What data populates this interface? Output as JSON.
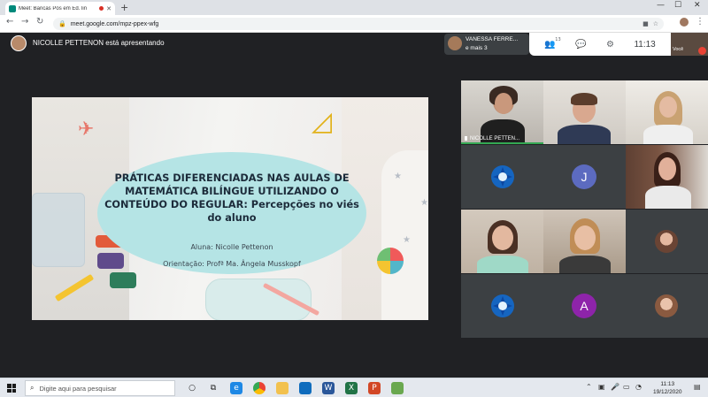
{
  "browser": {
    "tab_title": "Meet: Bancas Pós em Ed. lin",
    "url": "meet.google.com/mpz-ppex-wfg"
  },
  "meet": {
    "presenting_label": "NICOLLE PETTENON está apresentando",
    "people_name": "VANESSA FERRE...",
    "people_more": "e mais 3",
    "participant_count_badge": "13",
    "clock": "11:13",
    "self_label": "Você"
  },
  "slide": {
    "title": "PRÁTICAS DIFERENCIADAS NAS AULAS DE MATEMÁTICA BILÍNGUE UTILIZANDO O CONTEÚDO DO REGULAR: Percepções no viés do aluno",
    "author": "Aluna: Nicolle Pettenon",
    "advisor": "Orientação: Profª Ma. Ângela Musskopf"
  },
  "participants": [
    {
      "name": "NICOLLE PETTEN...",
      "type": "video"
    },
    {
      "name": "",
      "type": "video"
    },
    {
      "name": "",
      "type": "video"
    },
    {
      "name": "",
      "type": "logo"
    },
    {
      "name": "",
      "type": "letter",
      "letter": "J",
      "color": "#5c6bc0"
    },
    {
      "name": "",
      "type": "video"
    },
    {
      "name": "",
      "type": "video"
    },
    {
      "name": "",
      "type": "video"
    },
    {
      "name": "",
      "type": "avatar"
    },
    {
      "name": "",
      "type": "logo"
    },
    {
      "name": "",
      "type": "letter",
      "letter": "A",
      "color": "#8e24aa"
    },
    {
      "name": "",
      "type": "avatar"
    }
  ],
  "taskbar": {
    "search_placeholder": "Digite aqui para pesquisar",
    "time": "11:13",
    "date": "19/12/2020"
  },
  "colors": {
    "meet_bg": "#202124",
    "tile_bg": "#3c4043",
    "bubble": "#b5e4e5",
    "speaking_indicator": "#34a853"
  }
}
